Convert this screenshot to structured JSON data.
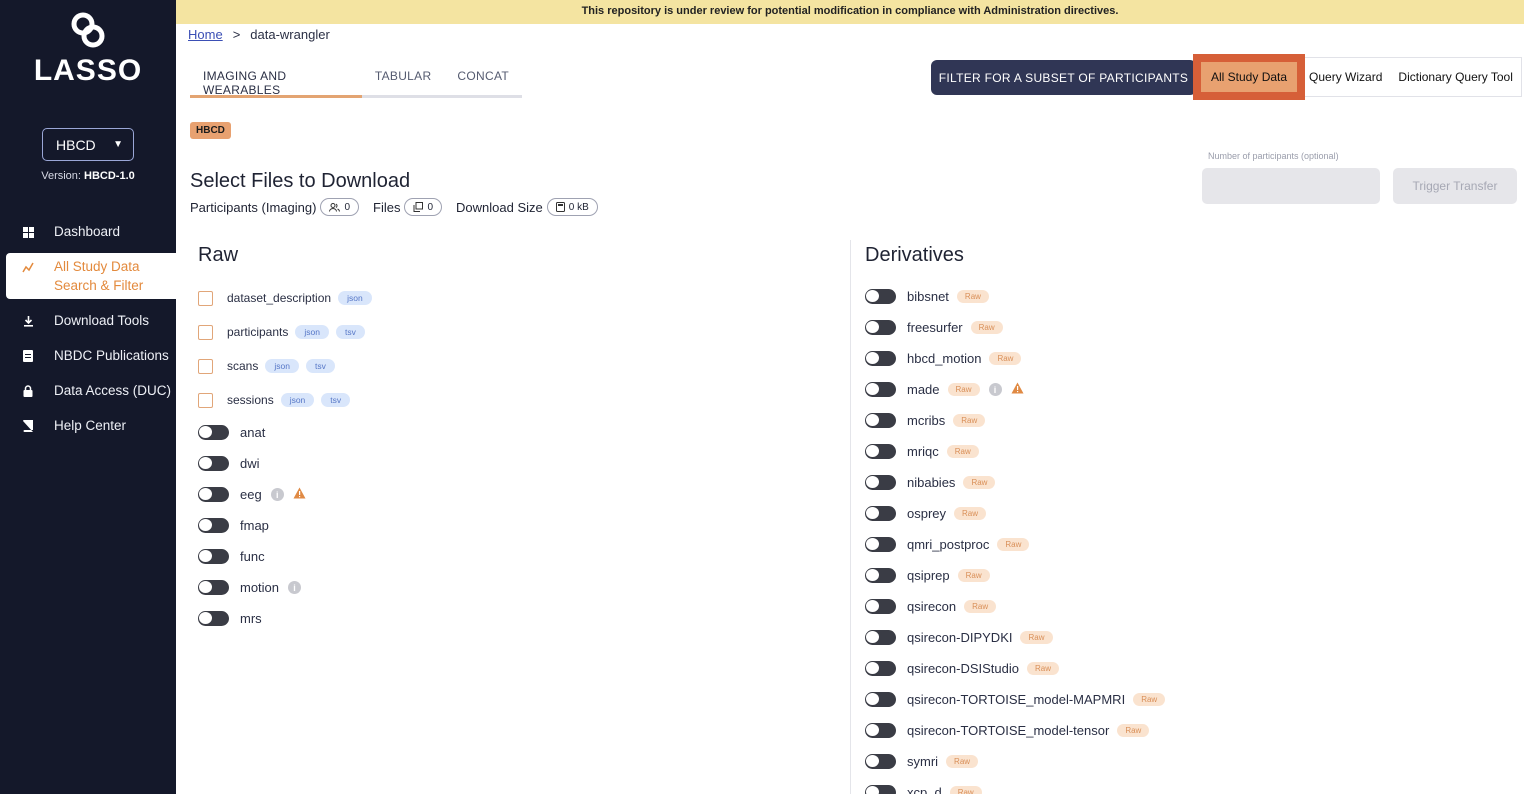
{
  "app": {
    "logo_text": "LASSO"
  },
  "banner": {
    "text": "This repository is under review for potential modification in compliance with Administration directives."
  },
  "sidebar": {
    "study": "HBCD",
    "version_label": "Version:",
    "version_value": "HBCD-1.0",
    "items": [
      {
        "label": "Dashboard",
        "icon": "grid-icon",
        "active": false
      },
      {
        "label": "All Study Data Search & Filter",
        "icon": "chart-icon",
        "active": true
      },
      {
        "label": "Download Tools",
        "icon": "download-icon",
        "active": false
      },
      {
        "label": "NBDC Publications",
        "icon": "document-icon",
        "active": false
      },
      {
        "label": "Data Access (DUC)",
        "icon": "lock-icon",
        "active": false
      },
      {
        "label": "Help Center",
        "icon": "book-icon",
        "active": false
      }
    ]
  },
  "breadcrumb": {
    "home": "Home",
    "separator": ">",
    "current": "data-wrangler"
  },
  "tabs": [
    {
      "label": "IMAGING AND WEARABLES",
      "active": true
    },
    {
      "label": "TABULAR",
      "active": false
    },
    {
      "label": "CONCAT",
      "active": false
    }
  ],
  "toolbar": {
    "filter_label": "FILTER FOR A SUBSET OF PARTICIPANTS",
    "right_tabs": [
      "All Study Data",
      "Query Wizard",
      "Dictionary Query Tool"
    ]
  },
  "badge": "HBCD",
  "transfer": {
    "participants_label": "Number of participants (optional)",
    "input_value": "",
    "trigger_label": "Trigger Transfer"
  },
  "selection": {
    "title": "Select Files to Download",
    "participants_label": "Participants (Imaging)",
    "participants_count": "0",
    "files_label": "Files",
    "files_count": "0",
    "size_label": "Download Size",
    "size_value": "0 kB"
  },
  "raw": {
    "title": "Raw",
    "files": [
      {
        "name": "dataset_description",
        "tags": [
          "json"
        ]
      },
      {
        "name": "participants",
        "tags": [
          "json",
          "tsv"
        ]
      },
      {
        "name": "scans",
        "tags": [
          "json",
          "tsv"
        ]
      },
      {
        "name": "sessions",
        "tags": [
          "json",
          "tsv"
        ]
      }
    ],
    "toggles": [
      {
        "name": "anat",
        "info": false,
        "warn": false
      },
      {
        "name": "dwi",
        "info": false,
        "warn": false
      },
      {
        "name": "eeg",
        "info": true,
        "warn": true
      },
      {
        "name": "fmap",
        "info": false,
        "warn": false
      },
      {
        "name": "func",
        "info": false,
        "warn": false
      },
      {
        "name": "motion",
        "info": true,
        "warn": false
      },
      {
        "name": "mrs",
        "info": false,
        "warn": false
      }
    ]
  },
  "derivatives": {
    "title": "Derivatives",
    "tag_label": "Raw",
    "items": [
      {
        "name": "bibsnet",
        "info": false,
        "warn": false
      },
      {
        "name": "freesurfer",
        "info": false,
        "warn": false
      },
      {
        "name": "hbcd_motion",
        "info": false,
        "warn": false
      },
      {
        "name": "made",
        "info": true,
        "warn": true
      },
      {
        "name": "mcribs",
        "info": false,
        "warn": false
      },
      {
        "name": "mriqc",
        "info": false,
        "warn": false
      },
      {
        "name": "nibabies",
        "info": false,
        "warn": false
      },
      {
        "name": "osprey",
        "info": false,
        "warn": false
      },
      {
        "name": "qmri_postproc",
        "info": false,
        "warn": false
      },
      {
        "name": "qsiprep",
        "info": false,
        "warn": false
      },
      {
        "name": "qsirecon",
        "info": false,
        "warn": false
      },
      {
        "name": "qsirecon-DIPYDKI",
        "info": false,
        "warn": false
      },
      {
        "name": "qsirecon-DSIStudio",
        "info": false,
        "warn": false
      },
      {
        "name": "qsirecon-TORTOISE_model-MAPMRI",
        "info": false,
        "warn": false
      },
      {
        "name": "qsirecon-TORTOISE_model-tensor",
        "info": false,
        "warn": false
      },
      {
        "name": "symri",
        "info": false,
        "warn": false
      },
      {
        "name": "xcp_d",
        "info": false,
        "warn": false
      }
    ]
  },
  "colors": {
    "sidebar": "#14182a",
    "accent": "#e8a170",
    "highlight": "#d65f38",
    "banner": "#f4e4a1"
  }
}
